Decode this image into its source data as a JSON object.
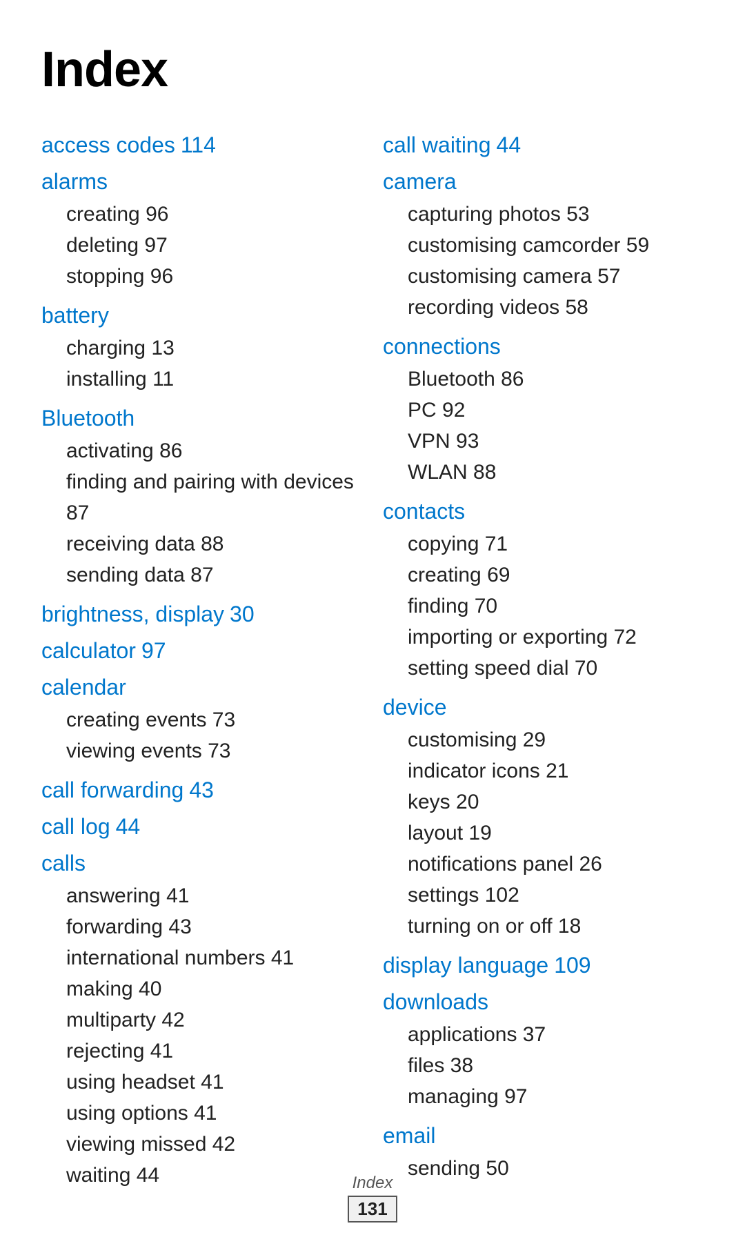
{
  "page": {
    "title": "Index",
    "footer_label": "Index",
    "footer_page": "131"
  },
  "left_column": [
    {
      "id": "access-codes",
      "term": "access codes",
      "number": "114",
      "subs": []
    },
    {
      "id": "alarms",
      "term": "alarms",
      "number": "",
      "subs": [
        {
          "text": "creating",
          "num": "96"
        },
        {
          "text": "deleting",
          "num": "97"
        },
        {
          "text": "stopping",
          "num": "96"
        }
      ]
    },
    {
      "id": "battery",
      "term": "battery",
      "number": "",
      "subs": [
        {
          "text": "charging",
          "num": "13"
        },
        {
          "text": "installing",
          "num": "11"
        }
      ]
    },
    {
      "id": "bluetooth",
      "term": "Bluetooth",
      "number": "",
      "subs": [
        {
          "text": "activating",
          "num": "86"
        },
        {
          "text": "finding and pairing with devices",
          "num": "87"
        },
        {
          "text": "receiving data",
          "num": "88"
        },
        {
          "text": "sending data",
          "num": "87"
        }
      ]
    },
    {
      "id": "brightness-display",
      "term": "brightness, display",
      "number": "30",
      "subs": []
    },
    {
      "id": "calculator",
      "term": "calculator",
      "number": "97",
      "subs": []
    },
    {
      "id": "calendar",
      "term": "calendar",
      "number": "",
      "subs": [
        {
          "text": "creating events",
          "num": "73"
        },
        {
          "text": "viewing events",
          "num": "73"
        }
      ]
    },
    {
      "id": "call-forwarding",
      "term": "call forwarding",
      "number": "43",
      "subs": []
    },
    {
      "id": "call-log",
      "term": "call log",
      "number": "44",
      "subs": []
    },
    {
      "id": "calls",
      "term": "calls",
      "number": "",
      "subs": [
        {
          "text": "answering",
          "num": "41"
        },
        {
          "text": "forwarding",
          "num": "43"
        },
        {
          "text": "international numbers",
          "num": "41"
        },
        {
          "text": "making",
          "num": "40"
        },
        {
          "text": "multiparty",
          "num": "42"
        },
        {
          "text": "rejecting",
          "num": "41"
        },
        {
          "text": "using headset",
          "num": "41"
        },
        {
          "text": "using options",
          "num": "41"
        },
        {
          "text": "viewing missed",
          "num": "42"
        },
        {
          "text": "waiting",
          "num": "44"
        }
      ]
    }
  ],
  "right_column": [
    {
      "id": "call-waiting",
      "term": "call waiting",
      "number": "44",
      "subs": []
    },
    {
      "id": "camera",
      "term": "camera",
      "number": "",
      "subs": [
        {
          "text": "capturing photos",
          "num": "53"
        },
        {
          "text": "customising camcorder",
          "num": "59"
        },
        {
          "text": "customising camera",
          "num": "57"
        },
        {
          "text": "recording videos",
          "num": "58"
        }
      ]
    },
    {
      "id": "connections",
      "term": "connections",
      "number": "",
      "subs": [
        {
          "text": "Bluetooth",
          "num": "86"
        },
        {
          "text": "PC",
          "num": "92"
        },
        {
          "text": "VPN",
          "num": "93"
        },
        {
          "text": "WLAN",
          "num": "88"
        }
      ]
    },
    {
      "id": "contacts",
      "term": "contacts",
      "number": "",
      "subs": [
        {
          "text": "copying",
          "num": "71"
        },
        {
          "text": "creating",
          "num": "69"
        },
        {
          "text": "finding",
          "num": "70"
        },
        {
          "text": "importing or exporting",
          "num": "72"
        },
        {
          "text": "setting speed dial",
          "num": "70"
        }
      ]
    },
    {
      "id": "device",
      "term": "device",
      "number": "",
      "subs": [
        {
          "text": "customising",
          "num": "29"
        },
        {
          "text": "indicator icons",
          "num": "21"
        },
        {
          "text": "keys",
          "num": "20"
        },
        {
          "text": "layout",
          "num": "19"
        },
        {
          "text": "notifications panel",
          "num": "26"
        },
        {
          "text": "settings",
          "num": "102"
        },
        {
          "text": "turning on or off",
          "num": "18"
        }
      ]
    },
    {
      "id": "display-language",
      "term": "display language",
      "number": "109",
      "subs": []
    },
    {
      "id": "downloads",
      "term": "downloads",
      "number": "",
      "subs": [
        {
          "text": "applications",
          "num": "37"
        },
        {
          "text": "files",
          "num": "38"
        },
        {
          "text": "managing",
          "num": "97"
        }
      ]
    },
    {
      "id": "email",
      "term": "email",
      "number": "",
      "subs": [
        {
          "text": "sending",
          "num": "50"
        }
      ]
    }
  ]
}
